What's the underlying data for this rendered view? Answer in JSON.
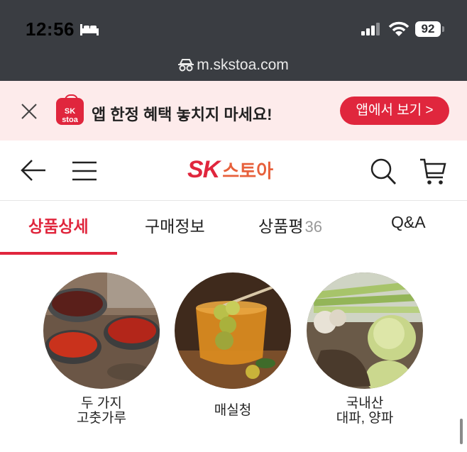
{
  "status": {
    "time": "12:56",
    "battery": "92",
    "url": "m.skstoa.com"
  },
  "banner": {
    "app_icon_text": "SK stoa",
    "text": "앱 한정 혜택 놓치지 마세요!",
    "button": "앱에서 보기 >"
  },
  "header": {
    "logo_sk": "SK",
    "logo_stoa": "스토아"
  },
  "tabs": [
    {
      "label": "상품상세",
      "active": true
    },
    {
      "label": "구매정보"
    },
    {
      "label": "상품평",
      "count": "36"
    },
    {
      "label": "Q&A"
    }
  ],
  "items": [
    {
      "line1": "두 가지",
      "line2": "고춧가루",
      "image": "chili-powder-bowls"
    },
    {
      "line1": "매실청",
      "line2": "",
      "image": "plum-syrup-glass"
    },
    {
      "line1": "국내산",
      "line2": "대파, 양파",
      "image": "green-onion-and-onion"
    }
  ],
  "colors": {
    "brand_red": "#e0263d",
    "stoa_orange": "#e7603b",
    "banner_bg": "#fdebeb",
    "statusbar_bg": "#3a3d42"
  }
}
